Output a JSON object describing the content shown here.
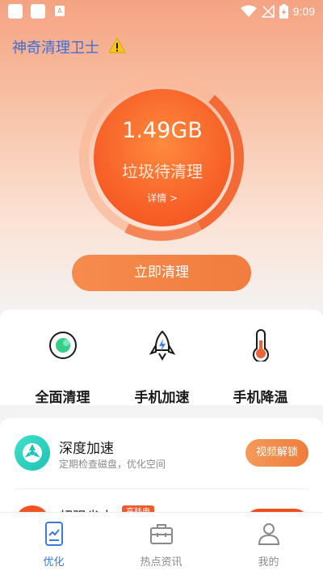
{
  "status_bar": {
    "time": "9:09"
  },
  "header": {
    "title": "神奇清理卫士"
  },
  "gauge": {
    "junk_size": "1.49GB",
    "label": "垃圾待清理",
    "detail_link": "详情 >"
  },
  "primary_action": {
    "label": "立即清理"
  },
  "tools": [
    {
      "label": "全面清理",
      "icon": "full-clean-icon"
    },
    {
      "label": "手机加速",
      "icon": "rocket-icon"
    },
    {
      "label": "手机降温",
      "icon": "thermometer-icon"
    }
  ],
  "features": [
    {
      "title": "深度加速",
      "subtitle": "定期检查磁盘，优化空间",
      "button": "视频解锁",
      "icon": "radiation-icon"
    },
    {
      "title": "超强省电",
      "tag": "高耗电"
    }
  ],
  "nav": [
    {
      "label": "优化",
      "icon": "phone-optimize-icon",
      "active": true
    },
    {
      "label": "热点资讯",
      "icon": "briefcase-icon",
      "active": false
    },
    {
      "label": "我的",
      "icon": "user-icon",
      "active": false
    }
  ],
  "colors": {
    "accent": "#f06b2e",
    "title_blue": "#3f6fd6",
    "nav_active": "#3a7be0"
  }
}
